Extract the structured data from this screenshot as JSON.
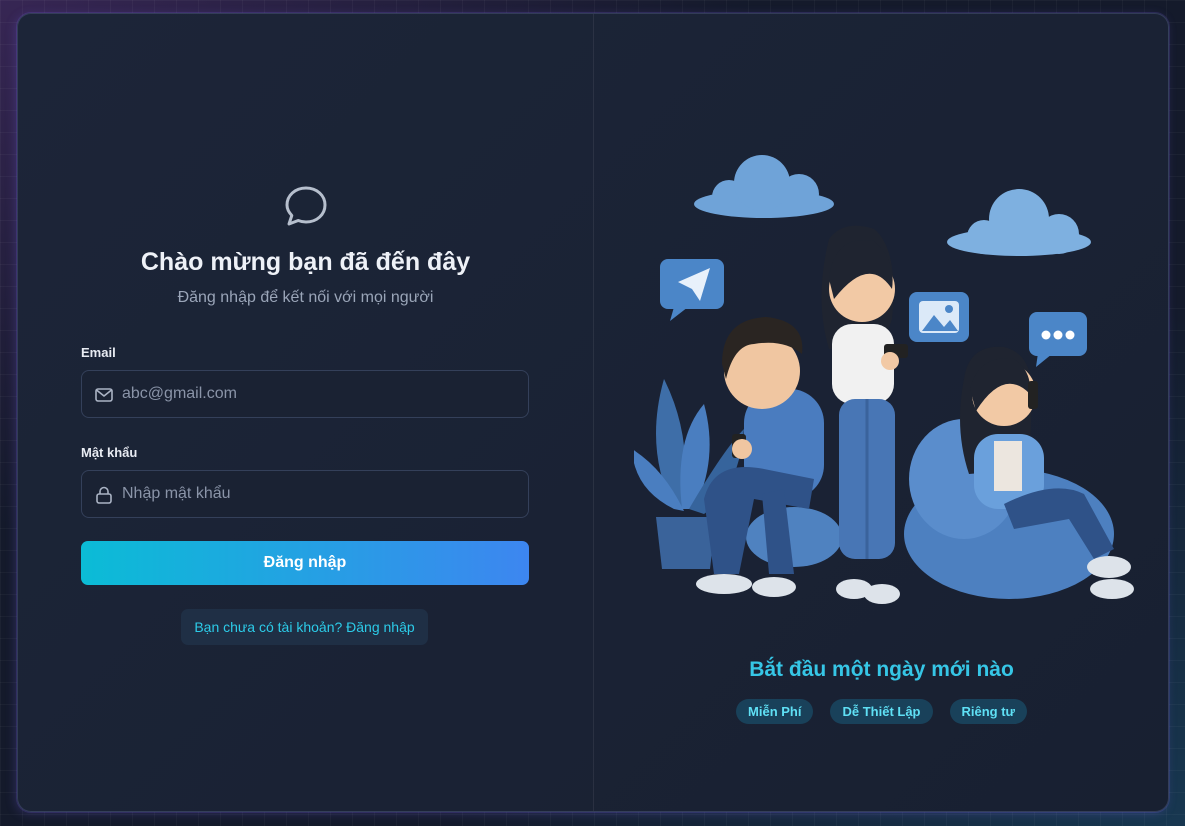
{
  "login": {
    "title": "Chào mừng bạn đã đến đây",
    "subtitle": "Đăng nhập để kết nối với mọi người",
    "email_label": "Email",
    "email_placeholder": "abc@gmail.com",
    "password_label": "Mật khẩu",
    "password_placeholder": "Nhập mật khẩu",
    "submit_label": "Đăng nhập",
    "register_link": "Bạn chưa có tài khoản? Đăng nhập"
  },
  "promo": {
    "tagline": "Bắt đầu một ngày mới nào",
    "features": [
      "Miễn Phí",
      "Dễ Thiết Lập",
      "Riêng tư"
    ]
  },
  "icons": {
    "logo": "chat-bubble-icon",
    "email": "mail-icon",
    "password": "lock-icon"
  },
  "colors": {
    "accent_start": "#0bbcd6",
    "accent_end": "#3d86f0",
    "tagline": "#36c6e6",
    "chip_bg": "#19415a",
    "chip_text": "#5fe0f5"
  }
}
